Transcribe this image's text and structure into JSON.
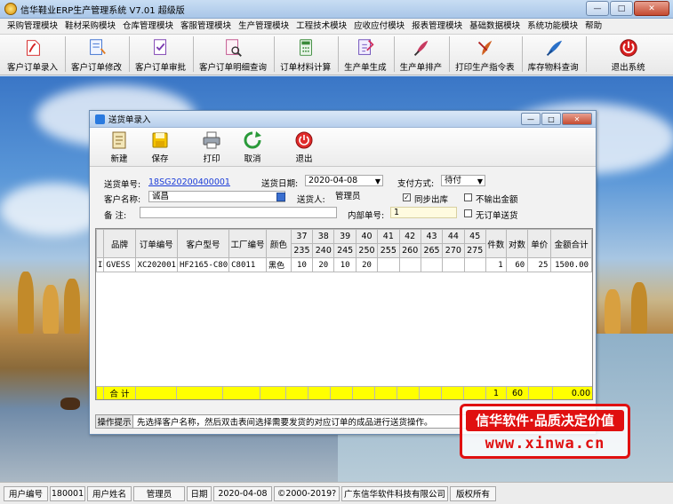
{
  "window": {
    "title": "信华鞋业ERP生产管理系统  V7.01  超级版",
    "controls": [
      "—",
      "□",
      "✕"
    ]
  },
  "menu": [
    "采购管理模块",
    "鞋材采购模块",
    "仓库管理模块",
    "客服管理模块",
    "生产管理模块",
    "工程技术模块",
    "应收应付模块",
    "报表管理模块",
    "基础数据模块",
    "系统功能模块",
    "帮助"
  ],
  "toolbar": [
    {
      "label": "客户订单录入",
      "icon": "pdf-icon",
      "color": "#d42020"
    },
    {
      "label": "客户订单修改",
      "icon": "document-edit-icon",
      "color": "#3a6fd0"
    },
    {
      "label": "客户订单审批",
      "icon": "approve-icon",
      "color": "#7a3ab0"
    },
    {
      "label": "客户订单明细查询",
      "icon": "search-detail-icon",
      "color": "#c0508a"
    },
    {
      "label": "订单材料计算",
      "icon": "calculator-icon",
      "color": "#3a8a3a"
    },
    {
      "label": "生产单生成",
      "icon": "generate-icon",
      "color": "#6a4ab8"
    },
    {
      "label": "生产单排产",
      "icon": "schedule-icon",
      "color": "#c83a60"
    },
    {
      "label": "打印生产指令表",
      "icon": "print-icon",
      "color": "#d06020"
    },
    {
      "label": "库存物料查询",
      "icon": "inventory-icon",
      "color": "#2a70c8"
    },
    {
      "label": "退出系统",
      "icon": "exit-icon",
      "color": "#d82020"
    }
  ],
  "dialog": {
    "title": "送货单录入",
    "controls": [
      "—",
      "□",
      "✕"
    ],
    "toolbar": [
      {
        "label": "新建",
        "icon": "new-doc-icon"
      },
      {
        "label": "保存",
        "icon": "save-icon"
      },
      {
        "label": "打印",
        "icon": "print-icon"
      },
      {
        "label": "取消",
        "icon": "cancel-refresh-icon"
      },
      {
        "label": "退出",
        "icon": "exit-icon"
      }
    ],
    "form": {
      "delivery_no_label": "送货单号:",
      "delivery_no": "18SG20200400001",
      "delivery_date_label": "送货日期:",
      "delivery_date": "2020-04-08",
      "payment_label": "支付方式:",
      "payment": "待付",
      "customer_label": "客户名称:",
      "customer": "诚昌",
      "deliverer_label": "送货人:",
      "deliverer": "管理员",
      "sync_label": "同步出库",
      "sync_checked": "✓",
      "no_amount_label": "不输出金额",
      "remark_label": "备  注:",
      "remark": "",
      "internal_no_label": "内部单号:",
      "internal_no": "1",
      "no_order_label": "无订单送货"
    },
    "grid": {
      "headers": {
        "brand": "品牌",
        "order_no": "订单编号",
        "cust_model": "客户型号",
        "factory_no": "工厂编号",
        "color": "颜色",
        "sizes_top": [
          "37",
          "38",
          "39",
          "40",
          "41",
          "42",
          "43",
          "44",
          "45"
        ],
        "sizes_bottom": [
          "235",
          "240",
          "245",
          "250",
          "255",
          "260",
          "265",
          "270",
          "275"
        ],
        "pieces": "件数",
        "pairs": "对数",
        "price": "单价",
        "amount": "金额合计"
      },
      "rows": [
        {
          "marker": "I",
          "brand": "GVESS",
          "order_no": "XC202001",
          "cust_model": "HF2165-C80",
          "factory_no": "C8011",
          "color": "黑色",
          "sizes": [
            "10",
            "20",
            "10",
            "20",
            "",
            "",
            "",
            "",
            ""
          ],
          "pieces": "1",
          "pairs": "60",
          "price": "25",
          "amount": "1500.00"
        }
      ],
      "total": {
        "label": "合  计",
        "pieces": "1",
        "pairs": "60",
        "amount": "0.00"
      }
    },
    "hint": {
      "label": "操作提示",
      "text": "先选择客户名称，然后双击表间选择需要发货的对应订单的成品进行送货操作。"
    }
  },
  "ad": {
    "line1": "信华软件·品质决定价值",
    "line2": "www.xinwa.cn"
  },
  "status": {
    "user_no_label": "用户编号",
    "user_no": "180001",
    "user_name_label": "用户姓名",
    "user_name": "管理员",
    "date_label": "日期",
    "date": "2020-04-08",
    "copyright": "©2000-2019?",
    "company": "广东信华软件科技有限公司",
    "rights": "版权所有"
  }
}
